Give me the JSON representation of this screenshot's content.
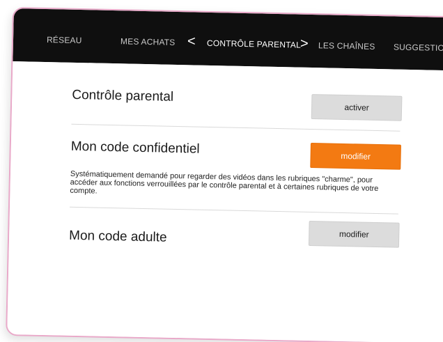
{
  "nav": {
    "items": [
      {
        "label": "RÉSEAU"
      },
      {
        "label": "MES ACHATS"
      },
      {
        "label": "CONTRÔLE PARENTAL"
      },
      {
        "label": "LES CHAÎNES"
      },
      {
        "label": "SUGGESTIONS D"
      }
    ],
    "prev_icon": "<",
    "next_icon": ">"
  },
  "sections": {
    "parental": {
      "title": "Contrôle parental",
      "button_label": "activer"
    },
    "confidential": {
      "title": "Mon code confidentiel",
      "button_label": "modifier",
      "description": "Systématiquement demandé pour regarder des vidéos dans les rubriques \"charme\", pour accéder aux fonctions verrouillées par le contrôle parental et à certaines rubriques de votre compte."
    },
    "adult": {
      "title": "Mon code adulte",
      "button_label": "modifier"
    }
  },
  "colors": {
    "nav_bg": "#0f0f0f",
    "accent_orange": "#f37a12",
    "button_grey": "#dcdcdc",
    "frame_pink": "#e9a9c9"
  }
}
